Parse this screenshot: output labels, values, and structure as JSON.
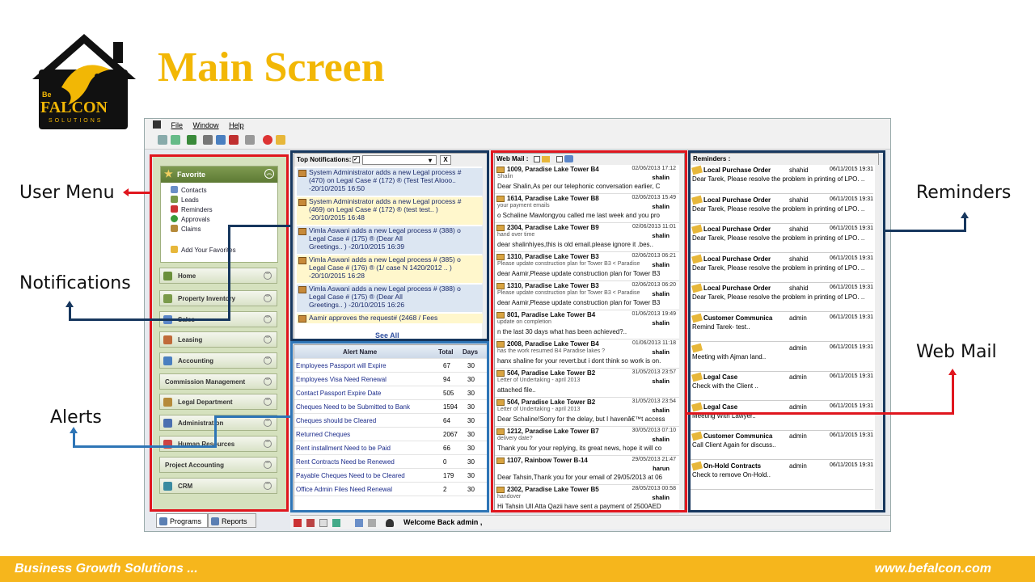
{
  "slide": {
    "title": "Main Screen",
    "logo_be": "Be",
    "logo_name": "FALCON",
    "logo_tag": "SOLUTIONS"
  },
  "callouts": {
    "user_menu": "User Menu",
    "notifications": "Notifications",
    "alerts": "Alerts",
    "reminders": "Reminders",
    "web_mail": "Web Mail"
  },
  "menubar": [
    "File",
    "Window",
    "Help"
  ],
  "sidebar": {
    "favorite": "Favorite",
    "fav_items": [
      "Contacts",
      "Leads",
      "Reminders",
      "Approvals",
      "Claims"
    ],
    "add_fav": "Add Your Favorites",
    "modules": [
      "Home",
      "Property Inventory",
      "Sales",
      "Leasing",
      "Accounting",
      "Commission Management",
      "Legal Department",
      "Administration",
      "Human Resources",
      "Project Accounting",
      "CRM"
    ]
  },
  "tabs": {
    "programs": "Programs",
    "reports": "Reports"
  },
  "notifications": {
    "header": "Top Notifications:",
    "close": "X",
    "see_all": "See All",
    "items": [
      {
        "l1": "System Administrator adds a new Legal process #",
        "l2": "(470) on Legal Case # (172)  ® (Test Test Alooo..",
        "l3": "-20/10/2015 16:50"
      },
      {
        "l1": "System Administrator adds a new Legal process #",
        "l2": "(469) on Legal Case # (172)  ® (test test.. )",
        "l3": "-20/10/2015 16:48"
      },
      {
        "l1": "Vimla Aswani adds a new Legal process # (388) o",
        "l2": "Legal Case # (175)  ® (Dear All",
        "l3": "Greetings.. )      -20/10/2015 16:39"
      },
      {
        "l1": "Vimla Aswani adds a new Legal process # (385) o",
        "l2": "Legal Case # (176)  ® (1/ case N 1420/2012 .. )",
        "l3": "-20/10/2015 16:28"
      },
      {
        "l1": "Vimla Aswani adds a new Legal process # (388) o",
        "l2": "Legal Case # (175)  ® (Dear All",
        "l3": "Greetings.. )      -20/10/2015 16:26"
      },
      {
        "l1": "Aamir approves the request# (2468 / Fees",
        "l2": "",
        "l3": ""
      }
    ]
  },
  "alerts": {
    "headers": [
      "Alert Name",
      "Total",
      "Days"
    ],
    "rows": [
      [
        "Employees Passport will Expire",
        "67",
        "30"
      ],
      [
        "Employees Visa Need Renewal",
        "94",
        "30"
      ],
      [
        "Contact Passport Expire Date",
        "505",
        "30"
      ],
      [
        "Cheques Need to be Submitted to Bank",
        "1594",
        "30"
      ],
      [
        "Cheques should be Cleared",
        "64",
        "30"
      ],
      [
        "Returned Cheques",
        "2067",
        "30"
      ],
      [
        "Rent installment Need to be Paid",
        "66",
        "30"
      ],
      [
        "Rent Contracts Need be Renewed",
        "0",
        "30"
      ],
      [
        "Payable Cheques Need to be Cleared",
        "179",
        "30"
      ],
      [
        "Office Admin Files Need Renewal",
        "2",
        "30"
      ]
    ]
  },
  "mail": {
    "header": "Web Mail :",
    "items": [
      {
        "t": "1009, Paradise Lake Tower B4",
        "d": "02/06/2013 17:12",
        "s": "Shalin",
        "f": "shalin",
        "p": "Dear Shalin,As per our telephonic conversation earlier, C"
      },
      {
        "t": "1614, Paradise Lake Tower B8",
        "d": "02/06/2013 15:49",
        "s": "your payment emails",
        "f": "shalin",
        "p": "o Schaline Mawlongyou called me last week and you pro"
      },
      {
        "t": "2304, Paradise Lake Tower B9",
        "d": "02/06/2013 11:01",
        "s": "hand over time",
        "f": "shalin",
        "p": "dear shalinhiyes,this is old email.please ignore it .bes.."
      },
      {
        "t": "1310, Paradise Lake Tower B3",
        "d": "02/06/2013 06:21",
        "s": "Please update construction plan for Tower B3 < Paradise",
        "f": "shalin",
        "p": "dear Aamir,Please update construction plan for Tower B3"
      },
      {
        "t": "1310, Paradise Lake Tower B3",
        "d": "02/06/2013 06:20",
        "s": "Please update construction plan for Tower B3 < Paradise",
        "f": "shalin",
        "p": "dear Aamir,Please update construction plan for Tower B3"
      },
      {
        "t": "801, Paradise Lake Tower B4",
        "d": "01/06/2013 19:49",
        "s": "update on completion",
        "f": "shalin",
        "p": "n the last 30 days what has been achieved?.."
      },
      {
        "t": "2008, Paradise Lake Tower B4",
        "d": "01/06/2013 11:18",
        "s": "has the work resumed B4 Paradise lakes ?",
        "f": "shalin",
        "p": "hanx shaline for your revert.but i dont think so work is on."
      },
      {
        "t": "504, Paradise Lake Tower B2",
        "d": "31/05/2013 23:57",
        "s": "Letter of Undertaking - april 2013",
        "f": "shalin",
        "p": "attached file.."
      },
      {
        "t": "504, Paradise Lake Tower B2",
        "d": "31/05/2013 23:54",
        "s": "Letter of Undertaking - april 2013",
        "f": "shalin",
        "p": "Dear Schaline!Sorry for the delay, but I havenâ€™t access"
      },
      {
        "t": "1212, Paradise Lake Tower B7",
        "d": "30/05/2013 07:10",
        "s": "delivery date?",
        "f": "shalin",
        "p": "Thank you for your replying, its great news, hope it will co"
      },
      {
        "t": "1107, Rainbow Tower B-14",
        "d": "29/05/2013 21:47",
        "s": "",
        "f": "harun",
        "p": "Dear Tahsin,Thank you for your email of 29/05/2013 at 06"
      },
      {
        "t": "2302, Paradise Lake Tower B5",
        "d": "28/05/2013 00:58",
        "s": "handover",
        "f": "shalin",
        "p": "Hi Tahsin Ull Atta Qazii have sent  a payment of 2500AED"
      }
    ]
  },
  "reminders": {
    "header": "Reminders :",
    "items": [
      {
        "t": "Local Purchase Order",
        "u": "shahid",
        "d": "06/11/2015 19:31",
        "p": "Dear Tarek, Please resolve the problem in printing of LPO. .."
      },
      {
        "t": "Local Purchase Order",
        "u": "shahid",
        "d": "06/11/2015 19:31",
        "p": "Dear Tarek, Please resolve the problem in printing of LPO. .."
      },
      {
        "t": "Local Purchase Order",
        "u": "shahid",
        "d": "06/11/2015 19:31",
        "p": "Dear Tarek, Please resolve the problem in printing of LPO. .."
      },
      {
        "t": "Local Purchase Order",
        "u": "shahid",
        "d": "06/11/2015 19:31",
        "p": "Dear Tarek, Please resolve the problem in printing of LPO. .."
      },
      {
        "t": "Local Purchase Order",
        "u": "shahid",
        "d": "06/11/2015 19:31",
        "p": "Dear Tarek, Please resolve the problem in printing of LPO. .."
      },
      {
        "t": "Customer Communica",
        "u": "admin",
        "d": "06/11/2015 19:31",
        "p": "Remind Tarek- test.."
      },
      {
        "t": "",
        "u": "admin",
        "d": "06/11/2015 19:31",
        "p": "Meeting with Ajman land.."
      },
      {
        "t": "Legal Case",
        "u": "admin",
        "d": "06/11/2015 19:31",
        "p": "Check with the Client .."
      },
      {
        "t": "Legal Case",
        "u": "admin",
        "d": "06/11/2015 19:31",
        "p": "Meeting With Lawyer.."
      },
      {
        "t": "Customer Communica",
        "u": "admin",
        "d": "06/11/2015 19:31",
        "p": "Call Client Again for discuss.."
      },
      {
        "t": "On-Hold Contracts",
        "u": "admin",
        "d": "06/11/2015 19:31",
        "p": "Check to remove On-Hold.."
      }
    ]
  },
  "status": {
    "welcome": "Welcome Back admin ,"
  },
  "footer": {
    "left": "Business Growth Solutions ...",
    "right": "www.befalcon.com"
  },
  "colors": {
    "title": "#F2B705",
    "footer": "#F6B61C",
    "red_box": "#E0161E",
    "navy_box": "#17375E"
  }
}
